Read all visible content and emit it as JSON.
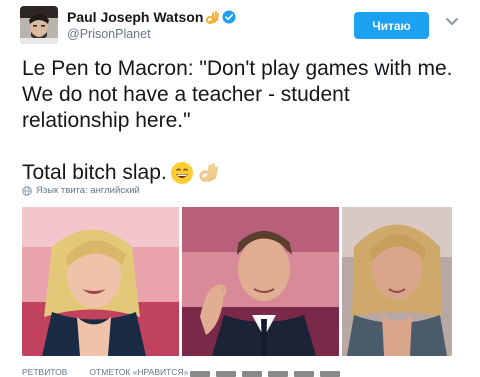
{
  "author": {
    "name": "Paul Joseph Watson",
    "handle": "@PrisonPlanet",
    "avatar_icon": "avatar-photo-icon",
    "name_emoji": "ok-hand-icon",
    "verified_icon": "verified-badge-icon"
  },
  "follow_button": {
    "label": "Читаю",
    "color": "#1da1f2"
  },
  "more_menu_icon": "chevron-down-icon",
  "tweet": {
    "line_1": "Le Pen to Macron: \"Don't play games with me. We do not have a teacher - student relationship here.\"",
    "line_2": "Total bitch slap.",
    "emojis": [
      "grinning-face-icon",
      "ok-hand-icon"
    ]
  },
  "language": {
    "icon": "globe-icon",
    "label": "Язык твита: английский"
  },
  "media": [
    {
      "name": "photo-le-pen"
    },
    {
      "name": "photo-macron"
    },
    {
      "name": "photo-woman"
    }
  ],
  "stats": {
    "retweets_label": "РЕТВИТОВ",
    "likes_label": "ОТМЕТОК «НРАВИТСЯ»"
  },
  "colors": {
    "accent": "#1da1f2",
    "text": "#14171a",
    "muted": "#657786"
  }
}
